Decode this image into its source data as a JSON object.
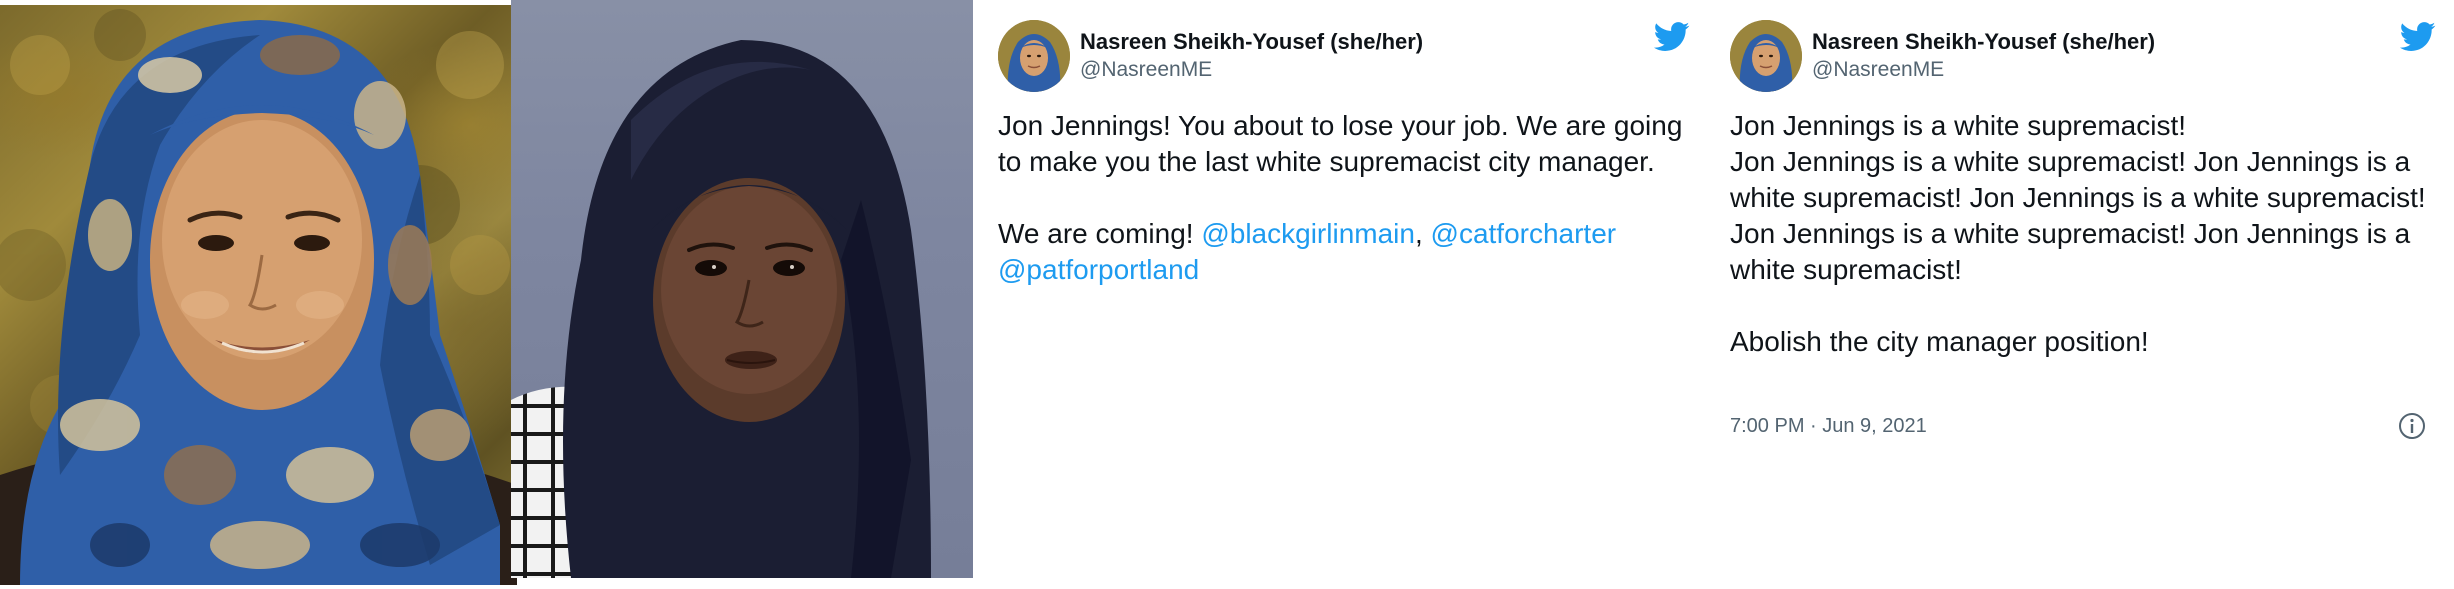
{
  "photos": {
    "left": {
      "kind": "portrait photo",
      "headscarf_color": "#2f5fa8"
    },
    "right": {
      "kind": "mugshot photo",
      "headscarf_color": "#171a2e",
      "background": "#7e86a0"
    }
  },
  "tweets": [
    {
      "author": {
        "display_name": "Nasreen Sheikh-Yousef (she/her)",
        "handle": "@NasreenME"
      },
      "body": {
        "paragraph1": "Jon Jennings! You about to lose your job. We are going to make you the last white supremacist city manager.",
        "line2_text": "We are coming! ",
        "mention1": "@blackgirlinmain",
        "separator": ", ",
        "mention2": "@catforcharter",
        "mention3": "@patforportland"
      },
      "brand_icon": "twitter-bird-icon"
    },
    {
      "author": {
        "display_name": "Nasreen Sheikh-Yousef (she/her)",
        "handle": "@NasreenME"
      },
      "body": {
        "line1": "Jon Jennings is a white supremacist!",
        "line2": "Jon Jennings is a white supremacist! Jon Jennings is a white supremacist! Jon Jennings is a white supremacist!",
        "line3": "Jon Jennings is a white supremacist! Jon Jennings is a white supremacist!",
        "line4": "Abolish the city manager position!"
      },
      "timestamp": "7:00 PM · Jun 9, 2021",
      "brand_icon": "twitter-bird-icon",
      "info_icon": "info-circle-icon"
    }
  ],
  "colors": {
    "twitter_blue": "#1d9bf0",
    "text_primary": "#0f1419",
    "text_secondary": "#536471"
  }
}
